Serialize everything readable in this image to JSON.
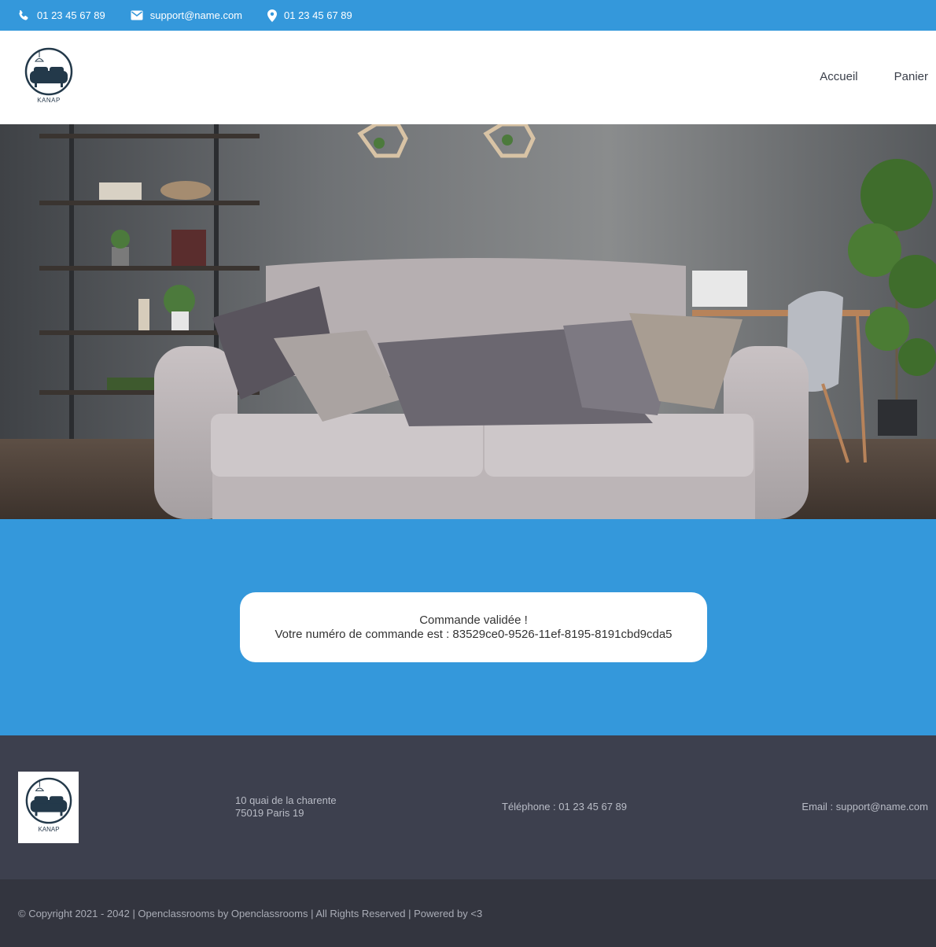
{
  "topbar": {
    "phone": "01 23 45 67 89",
    "email": "support@name.com",
    "location": "01 23 45 67 89"
  },
  "header": {
    "logo_text": "KANAP",
    "nav": {
      "home": "Accueil",
      "cart": "Panier"
    }
  },
  "confirmation": {
    "title": "Commande validée !",
    "prefix": "Votre numéro de commande est : ",
    "order_id": "83529ce0-9526-11ef-8195-8191cbd9cda5"
  },
  "footer": {
    "logo_text": "KANAP",
    "address_line1": "10 quai de la charente",
    "address_line2": "75019 Paris 19",
    "phone": "Téléphone : 01 23 45 67 89",
    "email": "Email : support@name.com",
    "copyright": "© Copyright 2021 - 2042 | Openclassrooms by Openclassrooms | All Rights Reserved | Powered by <3"
  },
  "colors": {
    "primary": "#3498db",
    "footer_bg": "#3d404e",
    "copyright_bg": "#33353f"
  }
}
